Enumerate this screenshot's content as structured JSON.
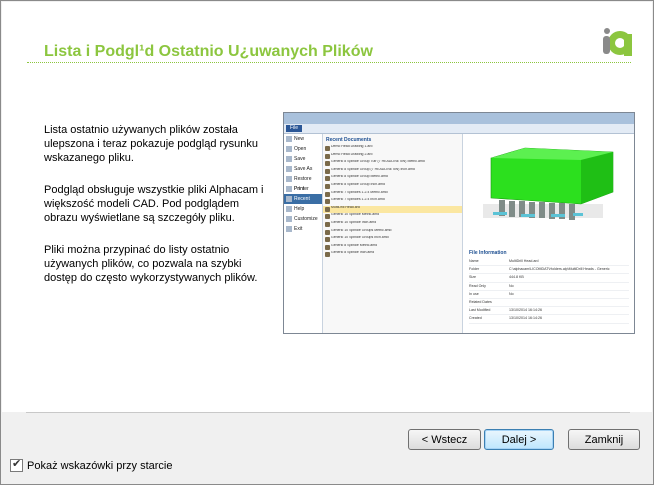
{
  "dialog": {
    "title": "Lista i Podgl¹d Ostatnio U¿uwanych Plików",
    "brand_color": "#8cc63f",
    "logo_icon": "alphacam-logo-icon"
  },
  "description": [
    "Lista ostatnio używanych plików została ulepszona i teraz pokazuje podgląd rysunku wskazanego pliku.",
    "Podgląd obsługuje wszystkie pliki Alphacam i większość modeli CAD. Pod podglądem obrazu wyświetlane są szczegóły pliku.",
    "Pliki można przypinać do listy ostatnio używanych plików, co pozwala na szybki dostęp do często wykorzystywanych plików."
  ],
  "buttons": {
    "back": "< Wstecz",
    "next": "Dalej >",
    "close": "Zamknij"
  },
  "startup_checkbox": {
    "label": "Pokaż wskazówki przy starcie",
    "checked": true
  },
  "preview": {
    "file_tab": "File",
    "menu": [
      "New",
      "Open",
      "Save",
      "Save As",
      "Restore Printer",
      "Print Preview",
      "Recent",
      "Help",
      "Customize",
      "Exit"
    ],
    "selected_menu": "Recent",
    "recent_header": "Recent Documents",
    "recent_files": [
      "Demo Head Drawing 1.ard",
      "Demo Head Drawing 2.ard",
      "Generic 8 Spindle Group Tutr (7 HEADLINE 5W) Metric.amd",
      "Generic 8 Spindle Group (7 HEADLINE 5W) Inch.amd",
      "Generic 8 Spindle Group Metric.amd",
      "Generic 8 Spindle Group Inch.amd",
      "Generic 7 Spindles 1.2.4 Metric.amd",
      "Generic 7 Spindles 1.2.4 Inch.amd",
      "MultiDrill Head.ard",
      "Generic 10 Spindle Metric.amd",
      "Generic 10 Spindle Inch.amd",
      "Generic 10 Spindle Groups Metric.amd",
      "Generic 10 Spindle Groups Inch.amd",
      "Generic 8 Spindle Metric.amd",
      "Generic 8 Spindle Inch.amd"
    ],
    "highlighted_index": 8,
    "info_header": "File Information",
    "info_rows": [
      {
        "k": "Name",
        "v": "MultiDrill Head.ard"
      },
      {
        "k": "Folder",
        "v": "C:\\alphacam\\LICOMDAT\\Holders.alp\\MultiDrill Heads - Generic"
      },
      {
        "k": "Size",
        "v": "444.8 KB"
      },
      {
        "k": "Read Only",
        "v": "No"
      },
      {
        "k": "In use",
        "v": "No"
      },
      {
        "k": "Related Dates",
        "v": ""
      },
      {
        "k": "Last Modified",
        "v": "13/10/2014 16:14:26"
      },
      {
        "k": "Created",
        "v": "13/10/2014 16:14:26"
      }
    ]
  }
}
